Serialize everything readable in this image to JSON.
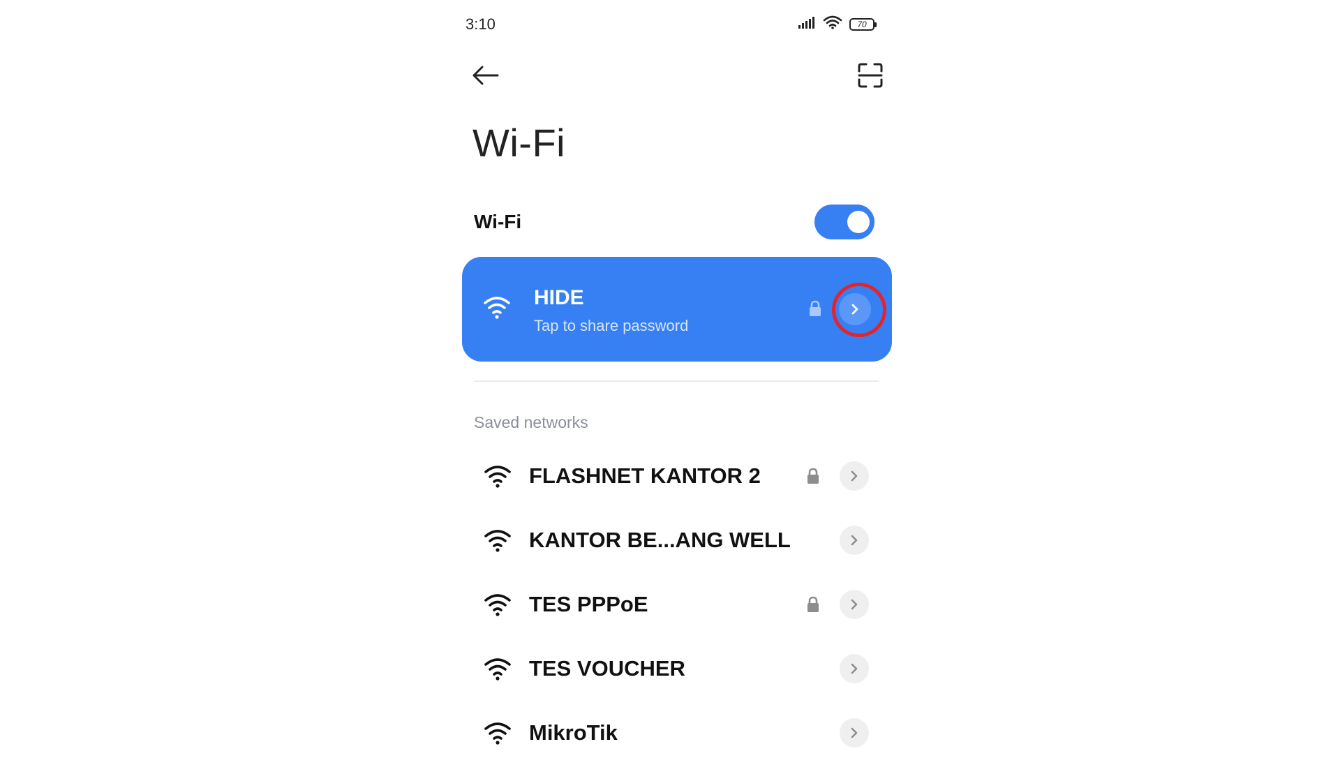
{
  "status_bar": {
    "time": "3:10",
    "battery_level": "70",
    "icons": [
      "signal-icon",
      "wifi-status-icon",
      "battery-icon"
    ]
  },
  "header": {
    "back_icon": "arrow-left-icon",
    "scan_icon": "qr-scan-icon",
    "title": "Wi-Fi"
  },
  "wifi_toggle": {
    "label": "Wi-Fi",
    "enabled": true
  },
  "connected_network": {
    "name": "HIDE",
    "subtitle": "Tap to share password",
    "secured": true,
    "highlighted": true
  },
  "saved_networks": {
    "header": "Saved networks",
    "items": [
      {
        "name": "FLASHNET KANTOR 2",
        "secured": true
      },
      {
        "name": "KANTOR BE...ANG WELL",
        "secured": false
      },
      {
        "name": "TES PPPoE",
        "secured": true
      },
      {
        "name": "TES VOUCHER",
        "secured": false
      },
      {
        "name": "MikroTik",
        "secured": false
      }
    ]
  },
  "colors": {
    "accent": "#3680f3",
    "highlight_ring": "#e3242b",
    "secondary_text": "#8a8f98"
  }
}
